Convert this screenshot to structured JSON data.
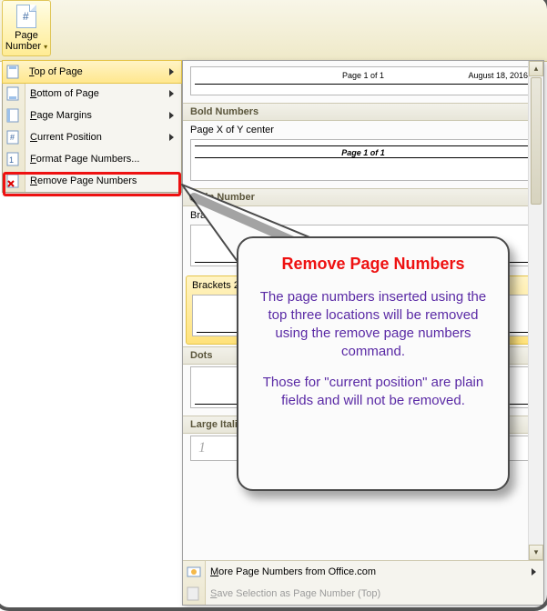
{
  "ribbon": {
    "page_number_label_1": "Page",
    "page_number_label_2": "Number"
  },
  "dropdown": {
    "items": [
      {
        "label": "Top of Page",
        "accel": "T",
        "submenu": true
      },
      {
        "label": "Bottom of Page",
        "accel": "B",
        "submenu": true
      },
      {
        "label": "Page Margins",
        "accel": "P",
        "submenu": true
      },
      {
        "label": "Current Position",
        "accel": "C",
        "submenu": true
      },
      {
        "label": "Format Page Numbers...",
        "accel": "F",
        "submenu": false
      },
      {
        "label": "Remove Page Numbers",
        "accel": "R",
        "submenu": false
      }
    ]
  },
  "submenu": {
    "group0": {
      "preview_left": "Page 1 of 1",
      "preview_right": "August 18, 2016"
    },
    "group1": {
      "title": "Bold Numbers",
      "entry": "Page X of Y center",
      "preview": "Page 1 of 1"
    },
    "group2": {
      "title": "Plain Number",
      "e1_title": "Brackets 1",
      "e2_title": "Brackets 2"
    },
    "group3": {
      "title": "Dots"
    },
    "group4": {
      "title": "Large Italics 1",
      "preview_num": "1"
    },
    "footer": {
      "more": "More Page Numbers from Office.com",
      "save": "Save Selection as Page Number (Top)"
    }
  },
  "callout": {
    "title": "Remove Page Numbers",
    "p1": "The page numbers inserted using the top three locations will be removed using the remove page numbers command.",
    "p2": "Those for \"current position\" are plain fields and will not be removed."
  }
}
